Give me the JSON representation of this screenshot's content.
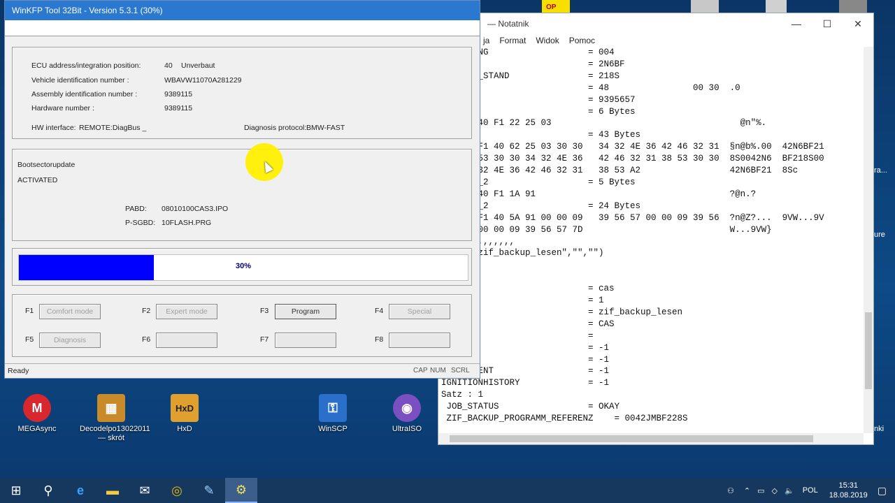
{
  "desktop": {
    "icons": [
      {
        "name": "megasync-shortcut",
        "label": "MEGAsync",
        "glyph": "M",
        "color": "#d9272e"
      },
      {
        "name": "decodelpo-shortcut",
        "label": "Decodelpo13022011\n— skrót",
        "glyph": "▦",
        "color": "#c98a2a"
      },
      {
        "name": "hxd-shortcut",
        "label": "HxD",
        "glyph": "HxD",
        "color": "#e0a030"
      },
      {
        "name": "winscp-shortcut",
        "label": "WinSCP",
        "glyph": "🔒",
        "color": "#2a6fc9"
      },
      {
        "name": "ultraiso-shortcut",
        "label": "UltraISO",
        "glyph": "◉",
        "color": "#7a4fc0"
      }
    ],
    "right_edge": {
      "label1": "ra...",
      "label2": "ure",
      "label3": "nki"
    },
    "top_label": "OP"
  },
  "notepad": {
    "title": "— Notatnik",
    "menu": [
      "ja",
      "Format",
      "Widok",
      "Pomoc"
    ],
    "lines": [
      "G_KENNUNG                   = 004",
      "ROJEKT                      = 2N6BF",
      "ROGRAMM_STAND               = 218S",
      "TATUS                       = 48                00 30  .0",
      "MW_HW                       = 9395657",
      "AUFTRAG                     = 6 Bytes",
      "0 : 83 40 F1 22 25 03                                    @n\"%.",
      "ANTWORT                     = 43 Bytes",
      "0 : A7 F1 40 62 25 03 30 30   34 32 4E 36 42 46 32 31  §n@b%.00  42N6BF21",
      "0 : 38 53 30 30 34 32 4E 36   42 46 32 31 38 53 30 30  8S0042N6  BF218S00",
      "0 : 34 32 4E 36 42 46 32 31   38 53 A2                 42N6BF21  8Sc",
      "AUFTRAG_2                   = 5 Bytes",
      "0 : 82 40 F1 1A 91                                     ?@n.?",
      "ANTWORT_2                   = 24 Bytes",
      "0 : 94 F1 40 5A 91 00 00 09   39 56 57 00 00 09 39 56  ?n@Z?...  9VW...9V",
      "0 : 57 00 00 09 39 56 57 7D                            W...9VW}",
      ",,,,,,,,,,,,,,",
      "\"CAS\",\"zif_backup_lesen\",\"\",\"\")",
      "",
      "0",
      "T                           = cas",
      "E                           = 1",
      "ME                          = zif_backup_lesen",
      "NTE                         = CAS",
      "TATUS                       =",
      "CURRENT                     = -1",
      "HISTORY                     = -1",
      "IONCURRENT                  = -1",
      "IGNITIONHISTORY             = -1",
      "Satz : 1",
      " JOB_STATUS                 = OKAY",
      " ZIF_BACKUP_PROGRAMM_REFERENZ    = 0042JMBF228S"
    ]
  },
  "kfp": {
    "title": "WinKFP Tool 32Bit - Version 5.3.1 (30%)",
    "info": {
      "ecu_label": "ECU address/integration position:",
      "ecu_value": "40",
      "ecu_extra": "Unverbaut",
      "vin_label": "Vehicle identification number :",
      "vin_value": "WBAVW11070A281229",
      "assembly_label": "Assembly identification number :",
      "assembly_value": "9389115",
      "hw_label": "Hardware number :",
      "hw_value": "9389115",
      "interface_label": "HW interface:",
      "interface_value": "REMOTE:DiagBus _",
      "protocol_label": "Diagnosis protocol:",
      "protocol_value": "BMW-FAST"
    },
    "boot": {
      "title": "Bootsectorupdate",
      "state": "ACTIVATED",
      "pabd_label": "PABD:",
      "pabd_value": "08010100CAS3.IPO",
      "psgbd_label": "P-SGBD:",
      "psgbd_value": "10FLASH.PRG"
    },
    "progress": {
      "value": 0.3,
      "text": "30%"
    },
    "fkeys": [
      {
        "key": "F1",
        "label": "Comfort mode"
      },
      {
        "key": "F2",
        "label": "Expert mode"
      },
      {
        "key": "F3",
        "label": "Program"
      },
      {
        "key": "F4",
        "label": "Special"
      },
      {
        "key": "F5",
        "label": "Diagnosis"
      },
      {
        "key": "F6",
        "label": ""
      },
      {
        "key": "F7",
        "label": ""
      },
      {
        "key": "F8",
        "label": ""
      }
    ],
    "status": "Ready",
    "indicators": [
      "CAP",
      "NUM",
      "SCRL"
    ]
  },
  "taskbar": {
    "language": "POL",
    "time": "15:31",
    "date": "18.08.2019"
  }
}
